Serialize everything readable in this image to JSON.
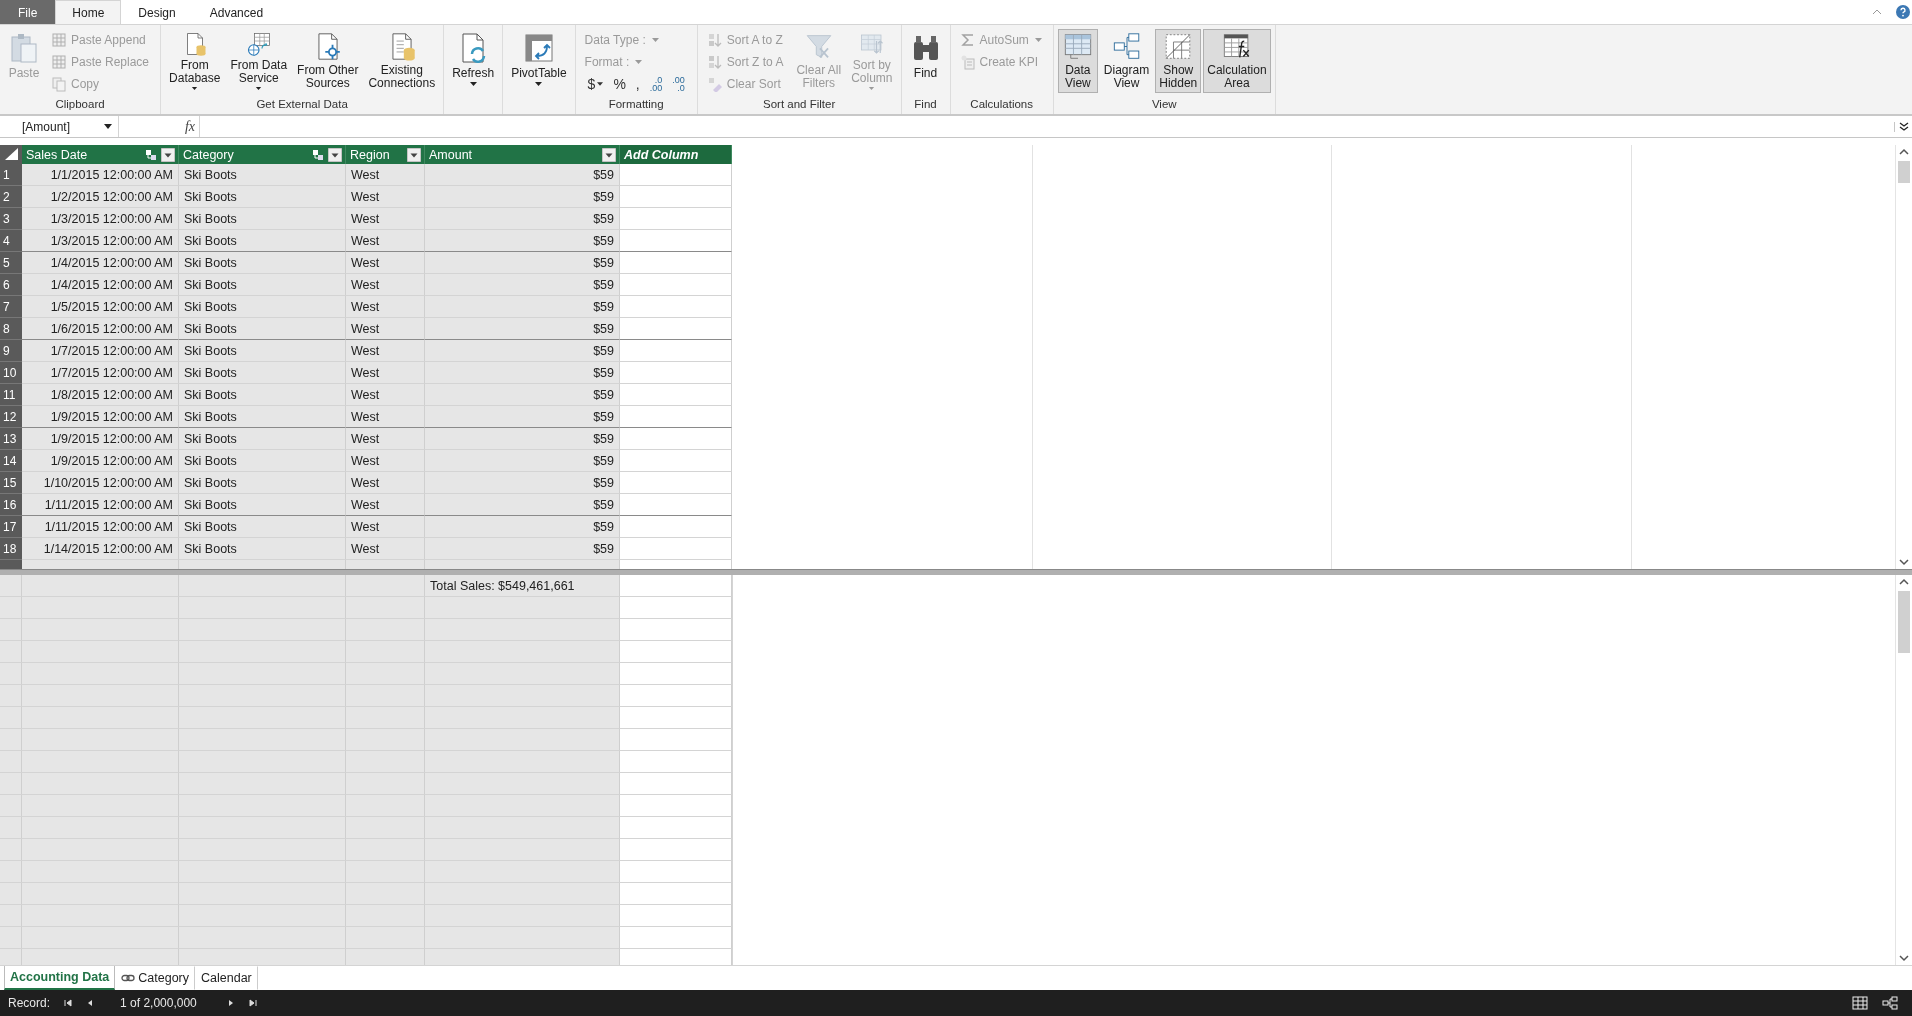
{
  "menu_tabs": [
    {
      "label": "File",
      "kind": "file",
      "selected": false
    },
    {
      "label": "Home",
      "kind": "tab",
      "selected": true
    },
    {
      "label": "Design",
      "kind": "tab",
      "selected": false
    },
    {
      "label": "Advanced",
      "kind": "tab",
      "selected": false
    }
  ],
  "ribbon_groups": [
    {
      "label": "Clipboard",
      "items": [
        {
          "kind": "large",
          "lines": [
            "Paste"
          ],
          "disabled": true
        },
        {
          "kind": "small",
          "label": "Paste Append",
          "disabled": true
        },
        {
          "kind": "small",
          "label": "Paste Replace",
          "disabled": true
        },
        {
          "kind": "small",
          "label": "Copy",
          "disabled": true
        }
      ]
    },
    {
      "label": "Get External Data",
      "items": [
        {
          "kind": "large",
          "lines": [
            "From",
            "Database"
          ],
          "dropdown": true,
          "disabled": false
        },
        {
          "kind": "large",
          "lines": [
            "From Data",
            "Service"
          ],
          "dropdown": true,
          "disabled": false
        },
        {
          "kind": "large",
          "lines": [
            "From Other",
            "Sources"
          ],
          "disabled": false
        },
        {
          "kind": "large",
          "lines": [
            "Existing",
            "Connections"
          ],
          "disabled": false
        }
      ]
    },
    {
      "items": [
        {
          "kind": "large",
          "lines": [
            "Refresh"
          ],
          "dropdown": true,
          "disabled": false
        }
      ]
    },
    {
      "items": [
        {
          "kind": "large",
          "lines": [
            "PivotTable"
          ],
          "dropdown": true,
          "disabled": false
        }
      ]
    },
    {
      "label": "Formatting",
      "items": [
        {
          "kind": "small",
          "label": "Data Type :",
          "dropdown": true,
          "disabled": true
        },
        {
          "kind": "small",
          "label": "Format :",
          "dropdown": true,
          "disabled": true
        },
        {
          "kind": "symbols",
          "buttons": [
            {
              "label": "$",
              "dropdown": true
            },
            {
              "label": "%"
            },
            {
              "label": ","
            },
            {
              "label": ".0",
              "sub": ".00"
            },
            {
              "label": ".00",
              "sub": ".0"
            }
          ]
        }
      ]
    },
    {
      "label": "Sort and Filter",
      "items": [
        {
          "kind": "small",
          "label": "Sort A to Z",
          "disabled": true
        },
        {
          "kind": "small",
          "label": "Sort Z to A",
          "disabled": true
        },
        {
          "kind": "small",
          "label": "Clear Sort",
          "disabled": true
        },
        {
          "kind": "large",
          "lines": [
            "Clear All",
            "Filters"
          ],
          "disabled": true
        },
        {
          "kind": "large",
          "lines": [
            "Sort by",
            "Column"
          ],
          "dropdown": true,
          "disabled": true
        }
      ]
    },
    {
      "label": "Find",
      "items": [
        {
          "kind": "large",
          "lines": [
            "Find"
          ],
          "disabled": false
        }
      ]
    },
    {
      "label": "Calculations",
      "items": [
        {
          "kind": "small",
          "label": "AutoSum",
          "dropdown": true,
          "disabled": true
        },
        {
          "kind": "small",
          "label": "Create KPI",
          "disabled": true
        }
      ]
    },
    {
      "label": "View",
      "items": [
        {
          "kind": "large",
          "lines": [
            "Data",
            "View"
          ],
          "selected": true,
          "disabled": false
        },
        {
          "kind": "large",
          "lines": [
            "Diagram",
            "View"
          ],
          "selected": false,
          "disabled": false
        },
        {
          "kind": "large",
          "lines": [
            "Show",
            "Hidden"
          ],
          "selected": true,
          "disabled": false
        },
        {
          "kind": "large",
          "lines": [
            "Calculation",
            "Area"
          ],
          "selected": true,
          "disabled": false
        }
      ]
    }
  ],
  "formula_bar": {
    "name_box": "[Amount]",
    "fx": "fx"
  },
  "table": {
    "columns": [
      {
        "label": "Sales Date",
        "kind": "date",
        "related": true,
        "filter": true
      },
      {
        "label": "Category",
        "kind": "text",
        "related": true,
        "filter": true
      },
      {
        "label": "Region",
        "kind": "text",
        "related": false,
        "filter": true
      },
      {
        "label": "Amount",
        "kind": "currency",
        "related": false,
        "filter": true
      },
      {
        "label": "Add Column",
        "kind": "add",
        "related": false,
        "filter": false
      }
    ],
    "rows": [
      {
        "number": "1",
        "cells": [
          "1/1/2015 12:00:00 AM",
          "Ski Boots",
          "West",
          "$59"
        ]
      },
      {
        "number": "2",
        "cells": [
          "1/2/2015 12:00:00 AM",
          "Ski Boots",
          "West",
          "$59"
        ]
      },
      {
        "number": "3",
        "cells": [
          "1/3/2015 12:00:00 AM",
          "Ski Boots",
          "West",
          "$59"
        ]
      },
      {
        "number": "4",
        "cells": [
          "1/3/2015 12:00:00 AM",
          "Ski Boots",
          "West",
          "$59"
        ]
      },
      {
        "number": "5",
        "cells": [
          "1/4/2015 12:00:00 AM",
          "Ski Boots",
          "West",
          "$59"
        ]
      },
      {
        "number": "6",
        "cells": [
          "1/4/2015 12:00:00 AM",
          "Ski Boots",
          "West",
          "$59"
        ]
      },
      {
        "number": "7",
        "cells": [
          "1/5/2015 12:00:00 AM",
          "Ski Boots",
          "West",
          "$59"
        ]
      },
      {
        "number": "8",
        "cells": [
          "1/6/2015 12:00:00 AM",
          "Ski Boots",
          "West",
          "$59"
        ]
      },
      {
        "number": "9",
        "cells": [
          "1/7/2015 12:00:00 AM",
          "Ski Boots",
          "West",
          "$59"
        ]
      },
      {
        "number": "10",
        "cells": [
          "1/7/2015 12:00:00 AM",
          "Ski Boots",
          "West",
          "$59"
        ]
      },
      {
        "number": "11",
        "cells": [
          "1/8/2015 12:00:00 AM",
          "Ski Boots",
          "West",
          "$59"
        ]
      },
      {
        "number": "12",
        "cells": [
          "1/9/2015 12:00:00 AM",
          "Ski Boots",
          "West",
          "$59"
        ]
      },
      {
        "number": "13",
        "cells": [
          "1/9/2015 12:00:00 AM",
          "Ski Boots",
          "West",
          "$59"
        ]
      },
      {
        "number": "14",
        "cells": [
          "1/9/2015 12:00:00 AM",
          "Ski Boots",
          "West",
          "$59"
        ]
      },
      {
        "number": "15",
        "cells": [
          "1/10/2015 12:00:00 AM",
          "Ski Boots",
          "West",
          "$59"
        ]
      },
      {
        "number": "16",
        "cells": [
          "1/11/2015 12:00:00 AM",
          "Ski Boots",
          "West",
          "$59"
        ]
      },
      {
        "number": "17",
        "cells": [
          "1/11/2015 12:00:00 AM",
          "Ski Boots",
          "West",
          "$59"
        ]
      },
      {
        "number": "18",
        "cells": [
          "1/14/2015 12:00:00 AM",
          "Ski Boots",
          "West",
          "$59"
        ]
      }
    ]
  },
  "calculation_area": {
    "measures": [
      "Total Sales: $549,461,661"
    ]
  },
  "sheet_tabs": [
    {
      "label": "Accounting Data",
      "linked": false,
      "selected": true
    },
    {
      "label": "Category",
      "linked": true,
      "selected": false
    },
    {
      "label": "Calendar",
      "linked": false,
      "selected": false
    }
  ],
  "status_bar": {
    "record_label": "Record:",
    "position": "1 of 2,000,000"
  }
}
